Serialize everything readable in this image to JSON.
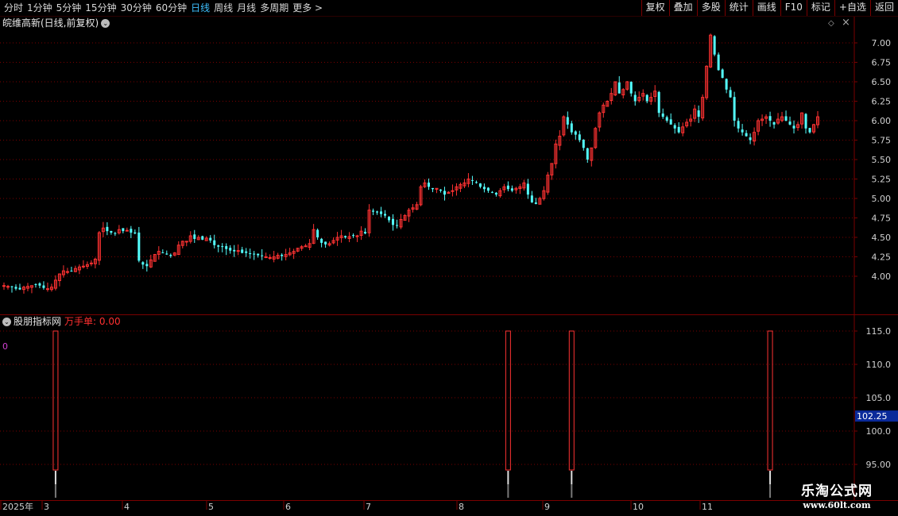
{
  "toolbar": {
    "periods": [
      {
        "label": "分时",
        "active": false
      },
      {
        "label": "1分钟",
        "active": false
      },
      {
        "label": "5分钟",
        "active": false
      },
      {
        "label": "15分钟",
        "active": false
      },
      {
        "label": "30分钟",
        "active": false
      },
      {
        "label": "60分钟",
        "active": false
      },
      {
        "label": "日线",
        "active": true
      },
      {
        "label": "周线",
        "active": false
      },
      {
        "label": "月线",
        "active": false
      },
      {
        "label": "多周期",
        "active": false
      },
      {
        "label": "更多 >",
        "active": false
      }
    ],
    "actions": [
      "复权",
      "叠加",
      "多股",
      "统计",
      "画线",
      "F10",
      "标记",
      "+自选",
      "返回"
    ]
  },
  "main_panel": {
    "title": "皖维高新(日线,前复权)",
    "price_axis": [
      "7.00",
      "6.75",
      "6.50",
      "6.25",
      "6.00",
      "5.75",
      "5.50",
      "5.25",
      "5.00",
      "4.75",
      "4.50",
      "4.25",
      "4.00"
    ]
  },
  "indicator_panel": {
    "name": "股朋指标网",
    "label": "万手单: 0.00",
    "zero_label": "0",
    "axis": [
      "115.0",
      "110.0",
      "105.0",
      "100.0",
      "95.00"
    ],
    "current_value": "102.25"
  },
  "time_axis": {
    "labels": [
      "2025年",
      "3",
      "4",
      "5",
      "6",
      "7",
      "8",
      "9",
      "10",
      "11"
    ]
  },
  "watermark": {
    "line1": "乐淘公式网",
    "line2": "www.60lt.com"
  },
  "colors": {
    "up": "#ff3232",
    "down": "#54ffff",
    "grid": "#7a0000",
    "axis_text": "#d0d0d0",
    "active_tab": "#3ec0ff",
    "indicator_label": "#ff3030",
    "value_box": "#0a2a9a"
  },
  "chart_data": [
    {
      "type": "candlestick",
      "title": "皖维高新(日线,前复权)",
      "ylim": [
        3.7,
        7.2
      ],
      "y_ticks": [
        4.0,
        4.25,
        4.5,
        4.75,
        5.0,
        5.25,
        5.5,
        5.75,
        6.0,
        6.25,
        6.5,
        6.75,
        7.0
      ],
      "x_ticks": [
        "2025年",
        "3",
        "4",
        "5",
        "6",
        "7",
        "8",
        "9",
        "10",
        "11"
      ],
      "closes": [
        3.88,
        3.87,
        3.86,
        3.84,
        3.83,
        3.86,
        3.87,
        3.88,
        3.89,
        3.88,
        3.85,
        3.84,
        3.86,
        3.95,
        4.03,
        4.07,
        4.06,
        4.07,
        4.1,
        4.12,
        4.13,
        4.15,
        4.17,
        4.22,
        4.56,
        4.62,
        4.58,
        4.56,
        4.55,
        4.6,
        4.58,
        4.59,
        4.56,
        4.55,
        4.2,
        4.15,
        4.13,
        4.21,
        4.28,
        4.32,
        4.3,
        4.28,
        4.26,
        4.3,
        4.4,
        4.45,
        4.45,
        4.52,
        4.48,
        4.5,
        4.47,
        4.49,
        4.46,
        4.4,
        4.38,
        4.38,
        4.35,
        4.33,
        4.32,
        4.33,
        4.3,
        4.3,
        4.29,
        4.28,
        4.27,
        4.26,
        4.25,
        4.24,
        4.25,
        4.27,
        4.26,
        4.28,
        4.3,
        4.32,
        4.36,
        4.38,
        4.39,
        4.42,
        4.6,
        4.5,
        4.43,
        4.41,
        4.42,
        4.46,
        4.5,
        4.52,
        4.5,
        4.51,
        4.52,
        4.52,
        4.58,
        4.55,
        4.85,
        4.83,
        4.82,
        4.8,
        4.78,
        4.72,
        4.66,
        4.65,
        4.73,
        4.78,
        4.85,
        4.88,
        4.92,
        5.15,
        5.2,
        5.15,
        5.12,
        5.13,
        5.1,
        5.05,
        5.08,
        5.1,
        5.15,
        5.18,
        5.2,
        5.25,
        5.23,
        5.2,
        5.15,
        5.12,
        5.1,
        5.08,
        5.05,
        5.1,
        5.15,
        5.12,
        5.1,
        5.13,
        5.15,
        5.2,
        5.05,
        4.95,
        4.93,
        5.0,
        5.1,
        5.3,
        5.45,
        5.7,
        5.8,
        6.05,
        5.95,
        5.85,
        5.82,
        5.75,
        5.65,
        5.5,
        5.65,
        5.9,
        6.1,
        6.2,
        6.25,
        6.35,
        6.5,
        6.35,
        6.4,
        6.5,
        6.35,
        6.25,
        6.3,
        6.35,
        6.25,
        6.3,
        6.38,
        6.1,
        6.05,
        6.0,
        5.95,
        5.9,
        5.85,
        5.92,
        5.98,
        6.02,
        6.15,
        6.05,
        6.3,
        6.7,
        7.1,
        6.85,
        6.65,
        6.55,
        6.4,
        6.3,
        6.0,
        5.9,
        5.85,
        5.8,
        5.75,
        5.85,
        6.0,
        6.02,
        6.05,
        6.0,
        5.95,
        6.02,
        6.05,
        6.0,
        5.95,
        5.9,
        5.95,
        6.1,
        5.9,
        5.85,
        5.95,
        6.05
      ]
    },
    {
      "type": "bar",
      "title": "万手单",
      "ylim": [
        93.0,
        116.0
      ],
      "y_ticks": [
        95.0,
        100.0,
        105.0,
        110.0,
        115.0
      ],
      "current_value": 102.25,
      "signal_bars": [
        {
          "x_index": 13,
          "value": 115.0
        },
        {
          "x_index": 127,
          "value": 115.0
        },
        {
          "x_index": 143,
          "value": 115.0
        },
        {
          "x_index": 193,
          "value": 115.0
        }
      ]
    }
  ]
}
